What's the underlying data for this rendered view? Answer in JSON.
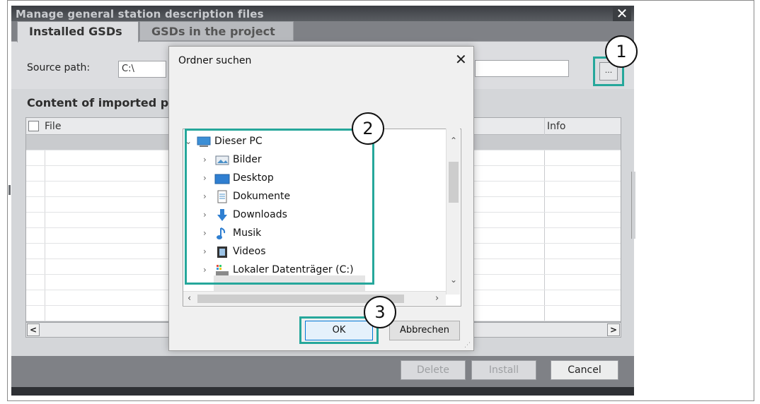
{
  "tia_dialog": {
    "title": "Manage general station description files",
    "close_glyph": "✕",
    "tabs": [
      {
        "label": "Installed GSDs",
        "active": true
      },
      {
        "label": "GSDs in the project",
        "active": false
      }
    ],
    "source_path_label": "Source path:",
    "source_path_value": "C:\\",
    "browse_button_label": "...",
    "content_heading": "Content of imported pa",
    "table": {
      "columns": [
        "File",
        "Info"
      ],
      "row_count": 12
    },
    "scroll_left_glyph": "<",
    "scroll_right_glyph": ">",
    "buttons": {
      "delete": "Delete",
      "install": "Install",
      "cancel": "Cancel"
    }
  },
  "ordner_dialog": {
    "title": "Ordner suchen",
    "close_glyph": "✕",
    "tree": [
      {
        "label": "Dieser PC",
        "expanded": true,
        "level": 0,
        "icon": "computer-icon"
      },
      {
        "label": "Bilder",
        "expanded": false,
        "level": 1,
        "icon": "pictures-icon"
      },
      {
        "label": "Desktop",
        "expanded": false,
        "level": 1,
        "icon": "desktop-icon"
      },
      {
        "label": "Dokumente",
        "expanded": false,
        "level": 1,
        "icon": "documents-icon"
      },
      {
        "label": "Downloads",
        "expanded": false,
        "level": 1,
        "icon": "download-icon"
      },
      {
        "label": "Musik",
        "expanded": false,
        "level": 1,
        "icon": "music-icon"
      },
      {
        "label": "Videos",
        "expanded": false,
        "level": 1,
        "icon": "videos-icon"
      },
      {
        "label": "Lokaler Datenträger (C:)",
        "expanded": false,
        "level": 1,
        "icon": "drive-icon",
        "selected": true
      }
    ],
    "ok_label": "OK",
    "cancel_label": "Abbrechen"
  },
  "callouts": [
    "1",
    "2",
    "3"
  ],
  "colors": {
    "highlight": "#26a79b",
    "tia_dark": "#3a3d42",
    "tia_panel": "#dcdde0"
  }
}
